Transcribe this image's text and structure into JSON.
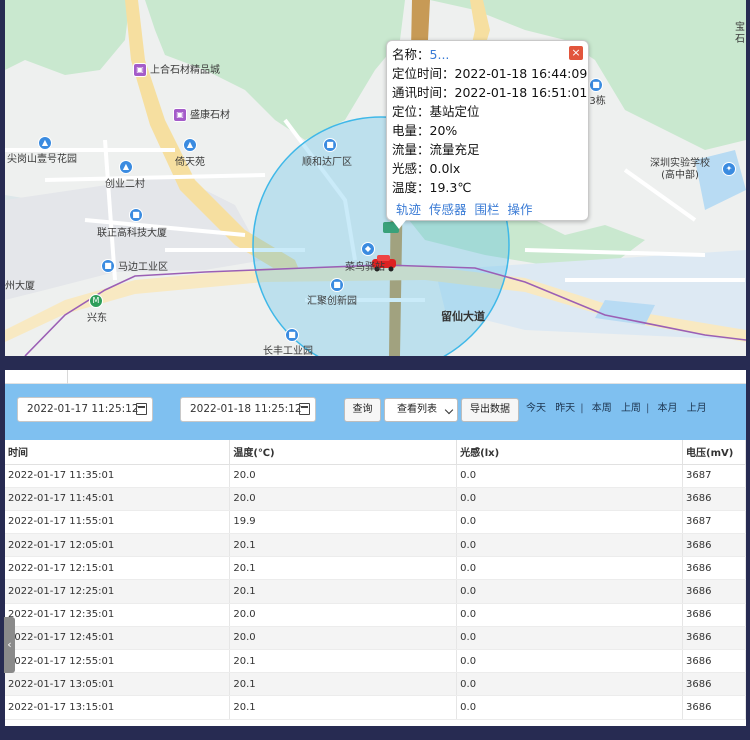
{
  "map": {
    "pois": [
      {
        "name": "上合石材精品城",
        "icon": "shop-icon"
      },
      {
        "name": "盛康石材",
        "icon": "shop-icon"
      },
      {
        "name": "尖岗山壹号花园",
        "icon": "residence-icon"
      },
      {
        "name": "倚天苑",
        "icon": "residence-icon"
      },
      {
        "name": "创业二村",
        "icon": "residence-icon"
      },
      {
        "name": "顺和达厂区",
        "icon": "building-icon"
      },
      {
        "name": "联正高科技大厦",
        "icon": "building-icon"
      },
      {
        "name": "马边工业区",
        "icon": "building-icon"
      },
      {
        "name": "州大厦",
        "icon": ""
      },
      {
        "name": "兴东",
        "icon": "metro-icon"
      },
      {
        "name": "菜鸟驿站",
        "icon": "package-icon"
      },
      {
        "name": "汇聚创新园",
        "icon": "building-icon"
      },
      {
        "name": "长丰工业园",
        "icon": "building-icon"
      },
      {
        "name": "深圳实验学校\n(高中部)",
        "icon": "school-icon"
      },
      {
        "name": "13栋",
        "icon": "building-icon"
      },
      {
        "name": "留仙大道",
        "icon": ""
      },
      {
        "name": "宝石",
        "icon": ""
      }
    ],
    "fence_color": "#3fb8e8",
    "route_color": "#9b5fb5"
  },
  "popup": {
    "rows": [
      {
        "label": "名称：",
        "value": "5..."
      },
      {
        "label": "定位时间：",
        "value": "2022-01-18 16:44:09"
      },
      {
        "label": "通讯时间：",
        "value": "2022-01-18 16:51:01"
      },
      {
        "label": "定位：",
        "value": "基站定位"
      },
      {
        "label": "电量：",
        "value": "20%"
      },
      {
        "label": "流量：",
        "value": "流量充足"
      },
      {
        "label": "光感：",
        "value": "0.0lx"
      },
      {
        "label": "温度：",
        "value": "19.3℃"
      }
    ],
    "close": "×",
    "actions": [
      "轨迹",
      "传感器",
      "围栏",
      "操作"
    ]
  },
  "toolbar": {
    "start_date": "2022-01-17 11:25:12",
    "end_date": "2022-01-18 11:25:12",
    "query": "查询",
    "view_select": "查看列表",
    "export": "导出数据",
    "quick_ranges": [
      "今天",
      "昨天",
      "本周",
      "上周",
      "本月",
      "上月"
    ]
  },
  "table": {
    "headers": [
      "时间",
      "温度(℃)",
      "光感(lx)",
      "电压(mV)"
    ],
    "rows": [
      [
        "2022-01-17 11:35:01",
        "20.0",
        "0.0",
        "3687"
      ],
      [
        "2022-01-17 11:45:01",
        "20.0",
        "0.0",
        "3686"
      ],
      [
        "2022-01-17 11:55:01",
        "19.9",
        "0.0",
        "3687"
      ],
      [
        "2022-01-17 12:05:01",
        "20.1",
        "0.0",
        "3686"
      ],
      [
        "2022-01-17 12:15:01",
        "20.1",
        "0.0",
        "3686"
      ],
      [
        "2022-01-17 12:25:01",
        "20.1",
        "0.0",
        "3686"
      ],
      [
        "2022-01-17 12:35:01",
        "20.0",
        "0.0",
        "3686"
      ],
      [
        "2022-01-17 12:45:01",
        "20.0",
        "0.0",
        "3686"
      ],
      [
        "2022-01-17 12:55:01",
        "20.1",
        "0.0",
        "3686"
      ],
      [
        "2022-01-17 13:05:01",
        "20.1",
        "0.0",
        "3686"
      ],
      [
        "2022-01-17 13:15:01",
        "20.1",
        "0.0",
        "3686"
      ]
    ]
  },
  "side_handle": "‹"
}
